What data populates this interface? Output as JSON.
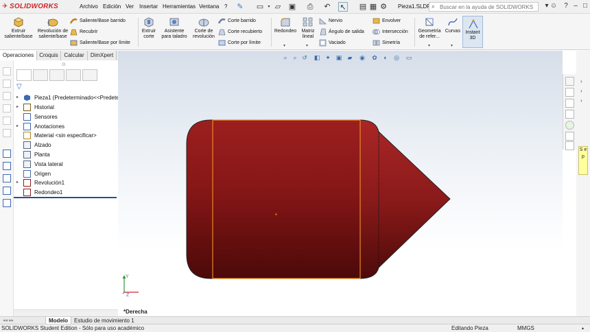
{
  "app": {
    "logo_text": "SOLIDWORKS",
    "document_title": "Pieza1.SLDP"
  },
  "menu": [
    "Archivo",
    "Edición",
    "Ver",
    "Insertar",
    "Herramientas",
    "Ventana",
    "?"
  ],
  "search": {
    "placeholder": "Buscar en la ayuda de SOLIDWORKS"
  },
  "commands": {
    "extrude_boss": "Extruir saliente/base",
    "revolve_boss": "Revolución de saliente/base",
    "swept_boss": "Saliente/Base barrido",
    "loft_boss": "Recubrir",
    "boundary_boss": "Saliente/Base por límite",
    "extrude_cut": "Extruir corte",
    "hole_wizard": "Asistente para taladro",
    "revolve_cut": "Corte de revolución",
    "swept_cut": "Corte barrido",
    "loft_cut": "Corte recubierto",
    "boundary_cut": "Corte por límite",
    "fillet": "Redondeo",
    "linear_pattern": "Matriz lineal",
    "rib": "Nervio",
    "draft": "Ángulo de salida",
    "shell": "Vaciado",
    "wrap": "Envolver",
    "intersect": "Intersección",
    "mirror": "Simetría",
    "ref_geometry": "Geometría de refer...",
    "curves": "Curvas",
    "instant3d": "Instant 3D"
  },
  "tabs": [
    "Operaciones",
    "Croquis",
    "Calcular",
    "DimXpert"
  ],
  "tree": {
    "part": "Pieza1 (Predeterminado<<Predeterm",
    "items": [
      {
        "label": "Historial",
        "expandable": true
      },
      {
        "label": "Sensores",
        "expandable": false
      },
      {
        "label": "Anotaciones",
        "expandable": true
      },
      {
        "label": "Material <sin especificar>",
        "expandable": false
      },
      {
        "label": "Alzado",
        "expandable": false
      },
      {
        "label": "Planta",
        "expandable": false
      },
      {
        "label": "Vista lateral",
        "expandable": false
      },
      {
        "label": "Origen",
        "expandable": false
      },
      {
        "label": "Revolución1",
        "expandable": true
      },
      {
        "label": "Redondeo1",
        "expandable": false
      }
    ]
  },
  "viewport": {
    "view_name": "*Derecha",
    "triad_axes": [
      "Y",
      "Z"
    ]
  },
  "note": {
    "text": "S e p"
  },
  "bottom_tabs": [
    "Modelo",
    "Estudio de movimiento 1"
  ],
  "status": {
    "left": "SOLIDWORKS Student Edition - Sólo para uso académico",
    "mode": "Editando Pieza",
    "units": "MMGS"
  },
  "colors": {
    "part_red": "#8b1a1a",
    "edge_orange": "#e98a25",
    "logo_red": "#d0262d",
    "selection_blue": "#1e4fa3"
  }
}
